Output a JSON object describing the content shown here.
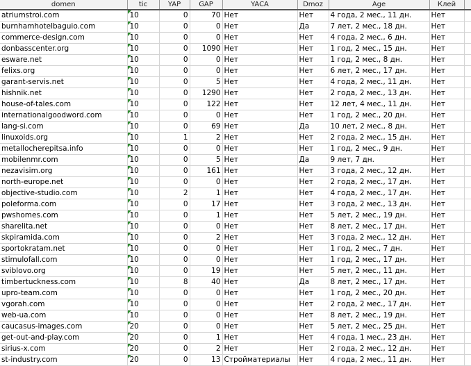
{
  "columns": [
    "domen",
    "tic",
    "YAP",
    "GAP",
    "YACA",
    "Dmoz",
    "Age",
    "Клей"
  ],
  "rows": [
    [
      "atriumstroi.com",
      "10",
      "0",
      "70",
      "Нет",
      "Нет",
      "4 года, 2 мес., 11 дн.",
      "Нет"
    ],
    [
      "burnhamhotelbaguio.com",
      "10",
      "0",
      "0",
      "Нет",
      "Да",
      "7 лет, 2 мес., 18 дн.",
      "Нет"
    ],
    [
      "commerce-design.com",
      "10",
      "0",
      "0",
      "Нет",
      "Нет",
      "4 года, 2 мес., 6 дн.",
      "Нет"
    ],
    [
      "donbasscenter.org",
      "10",
      "0",
      "1090",
      "Нет",
      "Нет",
      "1 год, 2 мес., 15 дн.",
      "Нет"
    ],
    [
      "esware.net",
      "10",
      "0",
      "0",
      "Нет",
      "Нет",
      "1 год, 2 мес., 8 дн.",
      "Нет"
    ],
    [
      "felixs.org",
      "10",
      "0",
      "0",
      "Нет",
      "Нет",
      "6 лет, 2 мес., 17 дн.",
      "Нет"
    ],
    [
      "garant-servis.net",
      "10",
      "0",
      "5",
      "Нет",
      "Нет",
      "4 года, 2 мес., 11 дн.",
      "Нет"
    ],
    [
      "hishnik.net",
      "10",
      "0",
      "1290",
      "Нет",
      "Нет",
      "2 года, 2 мес., 13 дн.",
      "Нет"
    ],
    [
      "house-of-tales.com",
      "10",
      "0",
      "122",
      "Нет",
      "Нет",
      "12 лет, 4 мес., 11 дн.",
      "Нет"
    ],
    [
      "internationalgoodword.com",
      "10",
      "0",
      "0",
      "Нет",
      "Нет",
      "1 год, 2 мес., 20 дн.",
      "Нет"
    ],
    [
      "lang-si.com",
      "10",
      "0",
      "69",
      "Нет",
      "Да",
      "10 лет, 2 мес., 8 дн.",
      "Нет"
    ],
    [
      "linuxoids.org",
      "10",
      "1",
      "2",
      "Нет",
      "Нет",
      "2 года, 2 мес., 15 дн.",
      "Нет"
    ],
    [
      "metallocherepitsa.info",
      "10",
      "0",
      "0",
      "Нет",
      "Нет",
      "1 год, 2 мес., 9 дн.",
      "Нет"
    ],
    [
      "mobilenmr.com",
      "10",
      "0",
      "5",
      "Нет",
      "Да",
      "9 лет, 7 дн.",
      "Нет"
    ],
    [
      "nezavisim.org",
      "10",
      "0",
      "161",
      "Нет",
      "Нет",
      "3 года, 2 мес., 12 дн.",
      "Нет"
    ],
    [
      "north-europe.net",
      "10",
      "0",
      "0",
      "Нет",
      "Нет",
      "2 года, 2 мес., 17 дн.",
      "Нет"
    ],
    [
      "objective-studio.com",
      "10",
      "2",
      "1",
      "Нет",
      "Нет",
      "4 года, 2 мес., 17 дн.",
      "Нет"
    ],
    [
      "poleforma.com",
      "10",
      "0",
      "17",
      "Нет",
      "Нет",
      "3 года, 2 мес., 13 дн.",
      "Нет"
    ],
    [
      "pwshomes.com",
      "10",
      "0",
      "1",
      "Нет",
      "Нет",
      "5 лет, 2 мес., 19 дн.",
      "Нет"
    ],
    [
      "sharelita.net",
      "10",
      "0",
      "0",
      "Нет",
      "Нет",
      "8 лет, 2 мес., 17 дн.",
      "Нет"
    ],
    [
      "skpiramida.com",
      "10",
      "0",
      "2",
      "Нет",
      "Нет",
      "3 года, 2 мес., 12 дн.",
      "Нет"
    ],
    [
      "sportokratam.net",
      "10",
      "0",
      "0",
      "Нет",
      "Нет",
      "1 год, 2 мес., 7 дн.",
      "Нет"
    ],
    [
      "stimulofall.com",
      "10",
      "0",
      "0",
      "Нет",
      "Нет",
      "1 год, 2 мес., 17 дн.",
      "Нет"
    ],
    [
      "sviblovo.org",
      "10",
      "0",
      "19",
      "Нет",
      "Нет",
      "5 лет, 2 мес., 11 дн.",
      "Нет"
    ],
    [
      "timbertuckness.com",
      "10",
      "8",
      "40",
      "Нет",
      "Да",
      "8 лет, 2 мес., 17 дн.",
      "Нет"
    ],
    [
      "upro-team.com",
      "10",
      "0",
      "0",
      "Нет",
      "Нет",
      "1 год, 2 мес., 20 дн.",
      "Нет"
    ],
    [
      "vgorah.com",
      "10",
      "0",
      "0",
      "Нет",
      "Нет",
      "2 года, 2 мес., 17 дн.",
      "Нет"
    ],
    [
      "web-ua.com",
      "10",
      "0",
      "0",
      "Нет",
      "Нет",
      "8 лет, 2 мес., 19 дн.",
      "Нет"
    ],
    [
      "caucasus-images.com",
      "20",
      "0",
      "0",
      "Нет",
      "Нет",
      "5 лет, 2 мес., 25 дн.",
      "Нет"
    ],
    [
      "get-out-and-play.com",
      "20",
      "0",
      "1",
      "Нет",
      "Нет",
      "4 года, 1 мес., 23 дн.",
      "Нет"
    ],
    [
      "sirius-x.com",
      "20",
      "0",
      "2",
      "Нет",
      "Нет",
      "2 года, 2 мес., 12 дн.",
      "Нет"
    ],
    [
      "st-industry.com",
      "20",
      "0",
      "13",
      "Стройматериалы",
      "Нет",
      "4 года, 2 мес., 11 дн.",
      "Нет"
    ]
  ]
}
